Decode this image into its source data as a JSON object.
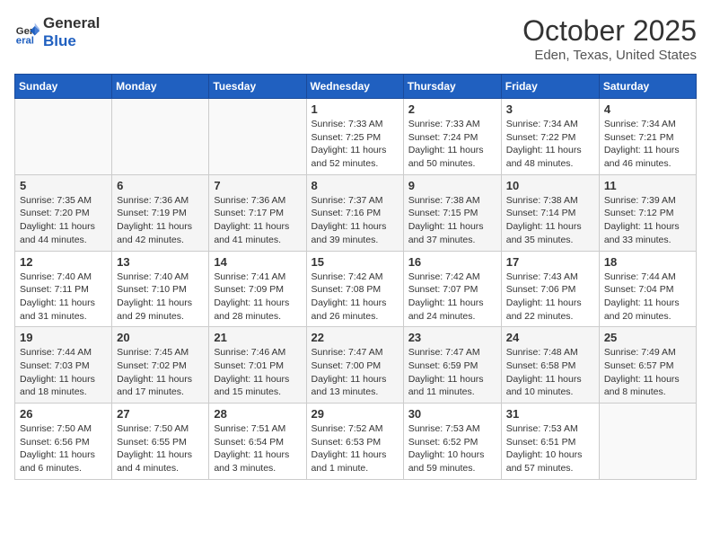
{
  "header": {
    "logo_line1": "General",
    "logo_line2": "Blue",
    "month": "October 2025",
    "location": "Eden, Texas, United States"
  },
  "weekdays": [
    "Sunday",
    "Monday",
    "Tuesday",
    "Wednesday",
    "Thursday",
    "Friday",
    "Saturday"
  ],
  "weeks": [
    [
      {
        "day": "",
        "info": ""
      },
      {
        "day": "",
        "info": ""
      },
      {
        "day": "",
        "info": ""
      },
      {
        "day": "1",
        "info": "Sunrise: 7:33 AM\nSunset: 7:25 PM\nDaylight: 11 hours\nand 52 minutes."
      },
      {
        "day": "2",
        "info": "Sunrise: 7:33 AM\nSunset: 7:24 PM\nDaylight: 11 hours\nand 50 minutes."
      },
      {
        "day": "3",
        "info": "Sunrise: 7:34 AM\nSunset: 7:22 PM\nDaylight: 11 hours\nand 48 minutes."
      },
      {
        "day": "4",
        "info": "Sunrise: 7:34 AM\nSunset: 7:21 PM\nDaylight: 11 hours\nand 46 minutes."
      }
    ],
    [
      {
        "day": "5",
        "info": "Sunrise: 7:35 AM\nSunset: 7:20 PM\nDaylight: 11 hours\nand 44 minutes."
      },
      {
        "day": "6",
        "info": "Sunrise: 7:36 AM\nSunset: 7:19 PM\nDaylight: 11 hours\nand 42 minutes."
      },
      {
        "day": "7",
        "info": "Sunrise: 7:36 AM\nSunset: 7:17 PM\nDaylight: 11 hours\nand 41 minutes."
      },
      {
        "day": "8",
        "info": "Sunrise: 7:37 AM\nSunset: 7:16 PM\nDaylight: 11 hours\nand 39 minutes."
      },
      {
        "day": "9",
        "info": "Sunrise: 7:38 AM\nSunset: 7:15 PM\nDaylight: 11 hours\nand 37 minutes."
      },
      {
        "day": "10",
        "info": "Sunrise: 7:38 AM\nSunset: 7:14 PM\nDaylight: 11 hours\nand 35 minutes."
      },
      {
        "day": "11",
        "info": "Sunrise: 7:39 AM\nSunset: 7:12 PM\nDaylight: 11 hours\nand 33 minutes."
      }
    ],
    [
      {
        "day": "12",
        "info": "Sunrise: 7:40 AM\nSunset: 7:11 PM\nDaylight: 11 hours\nand 31 minutes."
      },
      {
        "day": "13",
        "info": "Sunrise: 7:40 AM\nSunset: 7:10 PM\nDaylight: 11 hours\nand 29 minutes."
      },
      {
        "day": "14",
        "info": "Sunrise: 7:41 AM\nSunset: 7:09 PM\nDaylight: 11 hours\nand 28 minutes."
      },
      {
        "day": "15",
        "info": "Sunrise: 7:42 AM\nSunset: 7:08 PM\nDaylight: 11 hours\nand 26 minutes."
      },
      {
        "day": "16",
        "info": "Sunrise: 7:42 AM\nSunset: 7:07 PM\nDaylight: 11 hours\nand 24 minutes."
      },
      {
        "day": "17",
        "info": "Sunrise: 7:43 AM\nSunset: 7:06 PM\nDaylight: 11 hours\nand 22 minutes."
      },
      {
        "day": "18",
        "info": "Sunrise: 7:44 AM\nSunset: 7:04 PM\nDaylight: 11 hours\nand 20 minutes."
      }
    ],
    [
      {
        "day": "19",
        "info": "Sunrise: 7:44 AM\nSunset: 7:03 PM\nDaylight: 11 hours\nand 18 minutes."
      },
      {
        "day": "20",
        "info": "Sunrise: 7:45 AM\nSunset: 7:02 PM\nDaylight: 11 hours\nand 17 minutes."
      },
      {
        "day": "21",
        "info": "Sunrise: 7:46 AM\nSunset: 7:01 PM\nDaylight: 11 hours\nand 15 minutes."
      },
      {
        "day": "22",
        "info": "Sunrise: 7:47 AM\nSunset: 7:00 PM\nDaylight: 11 hours\nand 13 minutes."
      },
      {
        "day": "23",
        "info": "Sunrise: 7:47 AM\nSunset: 6:59 PM\nDaylight: 11 hours\nand 11 minutes."
      },
      {
        "day": "24",
        "info": "Sunrise: 7:48 AM\nSunset: 6:58 PM\nDaylight: 11 hours\nand 10 minutes."
      },
      {
        "day": "25",
        "info": "Sunrise: 7:49 AM\nSunset: 6:57 PM\nDaylight: 11 hours\nand 8 minutes."
      }
    ],
    [
      {
        "day": "26",
        "info": "Sunrise: 7:50 AM\nSunset: 6:56 PM\nDaylight: 11 hours\nand 6 minutes."
      },
      {
        "day": "27",
        "info": "Sunrise: 7:50 AM\nSunset: 6:55 PM\nDaylight: 11 hours\nand 4 minutes."
      },
      {
        "day": "28",
        "info": "Sunrise: 7:51 AM\nSunset: 6:54 PM\nDaylight: 11 hours\nand 3 minutes."
      },
      {
        "day": "29",
        "info": "Sunrise: 7:52 AM\nSunset: 6:53 PM\nDaylight: 11 hours\nand 1 minute."
      },
      {
        "day": "30",
        "info": "Sunrise: 7:53 AM\nSunset: 6:52 PM\nDaylight: 10 hours\nand 59 minutes."
      },
      {
        "day": "31",
        "info": "Sunrise: 7:53 AM\nSunset: 6:51 PM\nDaylight: 10 hours\nand 57 minutes."
      },
      {
        "day": "",
        "info": ""
      }
    ]
  ]
}
